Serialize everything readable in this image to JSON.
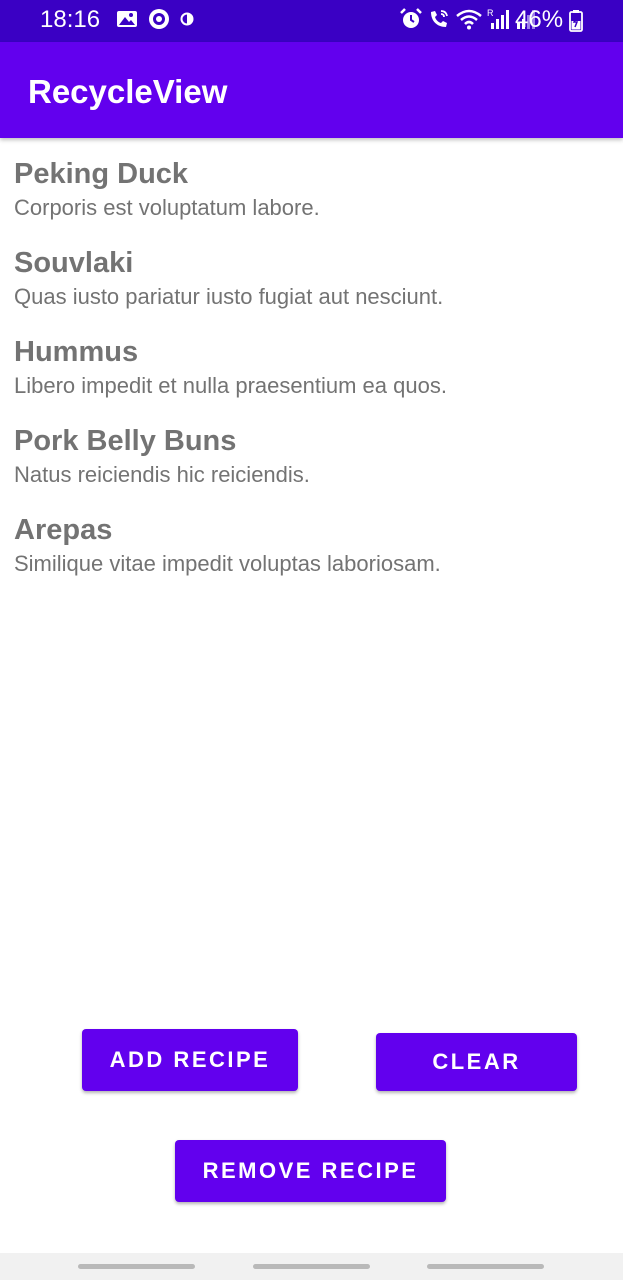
{
  "status_bar": {
    "time": "18:16",
    "battery": "46%",
    "icons": [
      "gallery-icon",
      "shield-icon",
      "data-saver-icon",
      "alarm-icon",
      "wifi-call-icon",
      "wifi-icon",
      "signal-r-icon",
      "signal-icon",
      "battery-icon"
    ]
  },
  "app_bar": {
    "title": "RecycleView"
  },
  "recipes": [
    {
      "name": "Peking Duck",
      "description": "Corporis est voluptatum labore."
    },
    {
      "name": "Souvlaki",
      "description": "Quas iusto pariatur iusto fugiat aut nesciunt."
    },
    {
      "name": "Hummus",
      "description": "Libero impedit et nulla praesentium ea quos."
    },
    {
      "name": "Pork Belly Buns",
      "description": "Natus reiciendis hic reiciendis."
    },
    {
      "name": "Arepas",
      "description": "Similique vitae impedit voluptas laboriosam."
    }
  ],
  "buttons": {
    "add_label": "ADD RECIPE",
    "clear_label": "CLEAR",
    "remove_label": "REMOVE RECIPE"
  },
  "colors": {
    "status_bar": "#3a00c4",
    "primary": "#6200ee",
    "text_secondary": "#737373",
    "nav_bar": "#f1f1f1"
  }
}
